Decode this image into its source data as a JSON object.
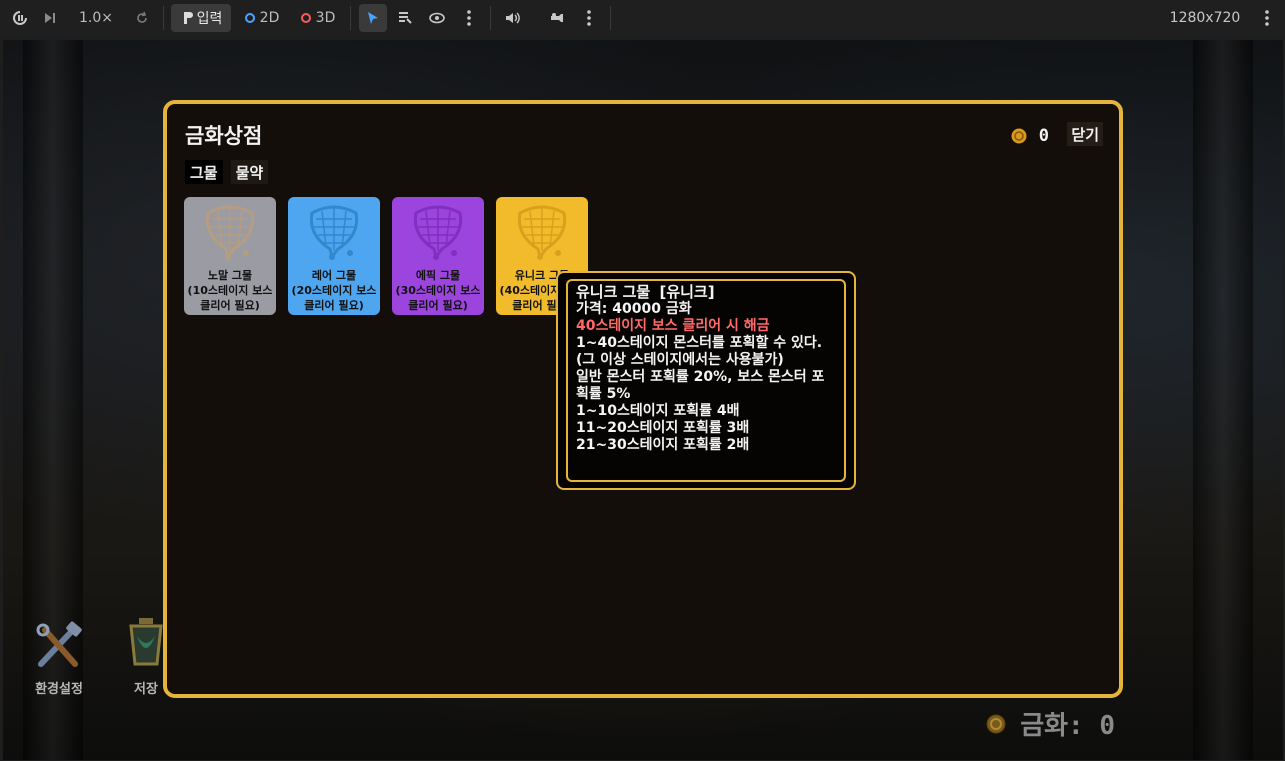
{
  "toolbar": {
    "speed": "1.0×",
    "mode_input": "입력",
    "mode_2d": "2D",
    "mode_3d": "3D",
    "resolution": "1280x720",
    "colors": {
      "dot_2d": "#4aa3ff",
      "dot_3d": "#ff5a5a",
      "select_active": "#4aa3ff"
    }
  },
  "hud": {
    "items": [
      {
        "label": "환경설정",
        "icon": "tools-icon"
      },
      {
        "label": "저장",
        "icon": "lantern-icon"
      }
    ],
    "currency_label": "금화: 0"
  },
  "shop": {
    "title": "금화상점",
    "coin_count": "0",
    "close_label": "닫기",
    "tabs": [
      {
        "label": "그물",
        "active": true
      },
      {
        "label": "물약",
        "active": false
      }
    ],
    "cards": [
      {
        "name": "노말 그물",
        "req": "(10스테이지 보스 클리어 필요)",
        "color": "#9b9ba3"
      },
      {
        "name": "레어 그물",
        "req": "(20스테이지 보스 클리어 필요)",
        "color": "#4da6ef"
      },
      {
        "name": "에픽 그물",
        "req": "(30스테이지 보스 클리어 필요)",
        "color": "#9b44de"
      },
      {
        "name": "유니크 그물",
        "req": "(40스테이지 보스 클리어 필요)",
        "color": "#f1bb2c"
      }
    ],
    "colors": {
      "border": "#e5b53a",
      "panel": "#140e0a"
    }
  },
  "tooltip": {
    "title": "유니크 그물",
    "rarity": "[유니크]",
    "price": "가격: 40000 금화",
    "unlock": "40스테이지 보스 클리어 시 해금",
    "desc1": "1~40스테이지 몬스터를 포획할 수 있다. (그 이상 스테이지에서는 사용불가)",
    "desc2": "일반 몬스터 포획률 20%, 보스 몬스터 포획률 5%",
    "bonus": [
      "1~10스테이지 포획률 4배",
      "11~20스테이지 포획률 3배",
      "21~30스테이지 포획률 2배"
    ],
    "colors": {
      "unlock_text": "#ff6b6b"
    }
  }
}
